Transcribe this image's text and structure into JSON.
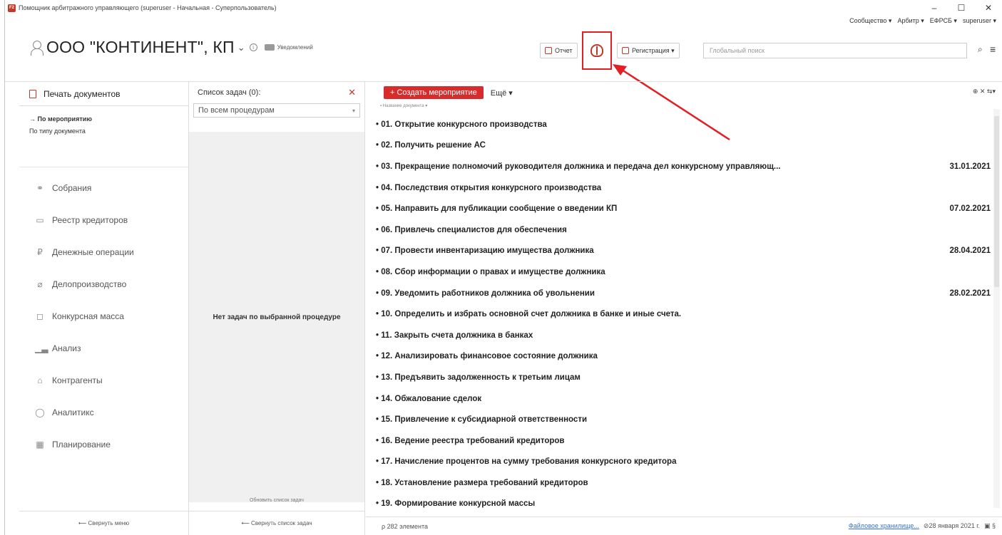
{
  "window": {
    "title": "Помощник арбитражного управляющего (superuser - Начальная - Суперпользователь)",
    "icon_text": "F2",
    "controls": [
      "–",
      "☐",
      "✕"
    ]
  },
  "top_links": [
    "Сообщество ▾",
    "Арбитр ▾",
    "ЕФРСБ ▾",
    "superuser ▾"
  ],
  "header": {
    "org_name": "ООО \"КОНТИНЕНТ\", КП",
    "org_chevron": "⌄",
    "info": "i",
    "notifications_label": "Уведомлений"
  },
  "toolbar": {
    "report_label": "Отчет",
    "registration_label": "Регистрация ▾",
    "search_placeholder": "Глобальный поиск"
  },
  "sidebar": {
    "header_label": "Печать документов",
    "sub_items": [
      {
        "label": "→ По мероприятию"
      },
      {
        "label": "По типу документа"
      }
    ],
    "items": [
      {
        "label": "Собрания",
        "icon": "handshake-icon",
        "glyph": "⚭"
      },
      {
        "label": "Реестр кредиторов",
        "icon": "registry-icon",
        "glyph": "▭"
      },
      {
        "label": "Денежные операции",
        "icon": "ruble-icon",
        "glyph": "₽"
      },
      {
        "label": "Делопроизводство",
        "icon": "paperclip-icon",
        "glyph": "⌀"
      },
      {
        "label": "Конкурсная масса",
        "icon": "box-icon",
        "glyph": "◻"
      },
      {
        "label": "Анализ",
        "icon": "bar-chart-icon",
        "glyph": "▁▃"
      },
      {
        "label": "Контрагенты",
        "icon": "bank-icon",
        "glyph": "⌂"
      },
      {
        "label": "Аналитикс",
        "icon": "analytics-search-icon",
        "glyph": "◯"
      },
      {
        "label": "Планирование",
        "icon": "calendar-icon",
        "glyph": "▦"
      }
    ],
    "collapse_label": "⟵  Свернуть меню"
  },
  "tasks": {
    "title": "Список задач (0):",
    "filter_value": "По всем процедурам",
    "empty_message": "Нет задач по выбранной процедуре",
    "refresh_label": "Обновить список задач",
    "collapse_label": "⟵  Свернуть список задач"
  },
  "main": {
    "create_label": "+ Создать мероприятие",
    "more_label": "Ещё ▾",
    "right_tools": "⊕  ✕  ⇆▾",
    "column_header": "▪ Название документа ▾",
    "documents": [
      {
        "title": "• 01. Открытие конкурсного производства",
        "date": ""
      },
      {
        "title": "• 02. Получить решение АС",
        "date": ""
      },
      {
        "title": "• 03.  Прекращение  полномочий  руководителя  должника  и  передача  дел  конкурсному  управляющ...",
        "date": "31.01.2021"
      },
      {
        "title": "• 04. Последствия открытия конкурсного производства",
        "date": ""
      },
      {
        "title": "• 05. Направить для публикации сообщение о введении КП",
        "date": "07.02.2021"
      },
      {
        "title": "• 06. Привлечь специалистов для обеспечения",
        "date": ""
      },
      {
        "title": "• 07. Провести инвентаризацию имущества должника",
        "date": "28.04.2021"
      },
      {
        "title": "• 08. Сбор информации о правах и имуществе должника",
        "date": ""
      },
      {
        "title": "• 09. Уведомить работников должника об увольнении",
        "date": "28.02.2021"
      },
      {
        "title": "• 10. Определить и избрать основной счет должника в банке и иные счета.",
        "date": ""
      },
      {
        "title": "• 11. Закрыть счета должника в банках",
        "date": ""
      },
      {
        "title": "• 12. Анализировать финансовое состояние должника",
        "date": ""
      },
      {
        "title": "• 13. Предъявить задолженность к третьим лицам",
        "date": ""
      },
      {
        "title": "• 14. Обжалование сделок",
        "date": ""
      },
      {
        "title": "• 15. Привлечение к субсидиарной ответственности",
        "date": ""
      },
      {
        "title": "• 16. Ведение реестра требований кредиторов",
        "date": ""
      },
      {
        "title": "• 17. Начисление процентов на сумму требования конкурсного кредитора",
        "date": ""
      },
      {
        "title": "• 18. Установление размера требований кредиторов",
        "date": ""
      },
      {
        "title": "• 19. Формирование конкурсной массы",
        "date": ""
      }
    ]
  },
  "status": {
    "count": "ρ  282 элемента",
    "storage_link": "Файловое хранилище...",
    "date": "⊘28 января 2021 г.",
    "icons": "▣  §"
  },
  "colors": {
    "accent_red": "#d62c2c",
    "highlight_red": "#e31e24",
    "link_blue": "#3a75c4"
  }
}
